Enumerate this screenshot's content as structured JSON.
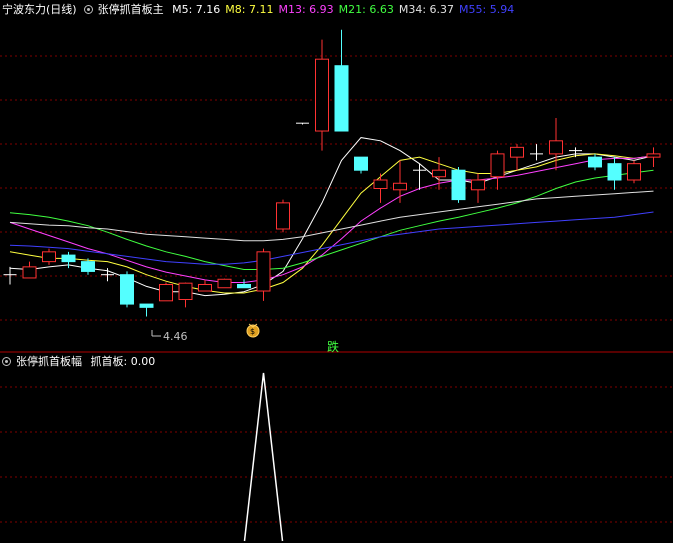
{
  "main_panel": {
    "stock_label": "宁波东力(日线)",
    "indicator_name": "张停抓首板主",
    "ma_readouts": [
      {
        "label": "M5: 7.16",
        "color": "#ffffff"
      },
      {
        "label": "M8: 7.11",
        "color": "#ffff40"
      },
      {
        "label": "M13: 6.93",
        "color": "#ff40ff"
      },
      {
        "label": "M21: 6.63",
        "color": "#40ff40"
      },
      {
        "label": "M34: 6.37",
        "color": "#e0e0e0"
      },
      {
        "label": "M55: 5.94",
        "color": "#4040ff"
      }
    ],
    "low_marker": "4.46",
    "signal_text": "跌",
    "signal_icon": "money-bag-icon"
  },
  "sub_panel": {
    "indicator_name": "张停抓首板幅",
    "readout": "抓首板: 0.00"
  },
  "colors": {
    "up": "#ff3232",
    "down": "#54ffff",
    "grid": "#800000",
    "signal": "#40ff40"
  },
  "chart_data": [
    {
      "type": "candlestick",
      "title": "宁波东力(日线)",
      "ylim": [
        4.1,
        9.0
      ],
      "candles": [
        {
          "o": 5.1,
          "h": 5.22,
          "l": 4.95,
          "c": 5.1
        },
        {
          "o": 5.05,
          "h": 5.3,
          "l": 5.05,
          "c": 5.22
        },
        {
          "o": 5.3,
          "h": 5.5,
          "l": 5.25,
          "c": 5.45
        },
        {
          "o": 5.4,
          "h": 5.45,
          "l": 5.2,
          "c": 5.3
        },
        {
          "o": 5.3,
          "h": 5.35,
          "l": 5.1,
          "c": 5.15
        },
        {
          "o": 5.1,
          "h": 5.2,
          "l": 5.0,
          "c": 5.1
        },
        {
          "o": 5.1,
          "h": 5.15,
          "l": 4.6,
          "c": 4.65
        },
        {
          "o": 4.65,
          "h": 4.62,
          "l": 4.46,
          "c": 4.6
        },
        {
          "o": 4.7,
          "h": 4.98,
          "l": 4.7,
          "c": 4.95
        },
        {
          "o": 4.72,
          "h": 4.98,
          "l": 4.6,
          "c": 4.97
        },
        {
          "o": 4.85,
          "h": 5.02,
          "l": 4.85,
          "c": 4.95
        },
        {
          "o": 4.9,
          "h": 5.04,
          "l": 4.9,
          "c": 5.03
        },
        {
          "o": 4.95,
          "h": 5.03,
          "l": 4.9,
          "c": 4.9
        },
        {
          "o": 4.85,
          "h": 5.5,
          "l": 4.7,
          "c": 5.45
        },
        {
          "o": 5.8,
          "h": 6.25,
          "l": 5.75,
          "c": 6.2
        },
        {
          "o": 7.42,
          "h": 7.42,
          "l": 7.4,
          "c": 7.42
        },
        {
          "o": 7.3,
          "h": 8.7,
          "l": 7.0,
          "c": 8.4
        },
        {
          "o": 8.3,
          "h": 8.85,
          "l": 7.3,
          "c": 7.3
        },
        {
          "o": 6.9,
          "h": 6.9,
          "l": 6.65,
          "c": 6.7
        },
        {
          "o": 6.42,
          "h": 6.65,
          "l": 6.2,
          "c": 6.55
        },
        {
          "o": 6.4,
          "h": 6.85,
          "l": 6.2,
          "c": 6.5
        },
        {
          "o": 6.7,
          "h": 6.8,
          "l": 6.4,
          "c": 6.7
        },
        {
          "o": 6.6,
          "h": 6.9,
          "l": 6.4,
          "c": 6.7
        },
        {
          "o": 6.7,
          "h": 6.75,
          "l": 6.2,
          "c": 6.25
        },
        {
          "o": 6.4,
          "h": 6.65,
          "l": 6.2,
          "c": 6.55
        },
        {
          "o": 6.6,
          "h": 7.0,
          "l": 6.4,
          "c": 6.95
        },
        {
          "o": 6.9,
          "h": 7.1,
          "l": 6.7,
          "c": 7.05
        },
        {
          "o": 6.95,
          "h": 7.1,
          "l": 6.85,
          "c": 6.95
        },
        {
          "o": 6.95,
          "h": 7.5,
          "l": 6.7,
          "c": 7.15
        },
        {
          "o": 7.0,
          "h": 7.05,
          "l": 6.9,
          "c": 6.98
        },
        {
          "o": 6.9,
          "h": 6.95,
          "l": 6.7,
          "c": 6.75
        },
        {
          "o": 6.8,
          "h": 6.9,
          "l": 6.4,
          "c": 6.55
        },
        {
          "o": 6.55,
          "h": 6.85,
          "l": 6.5,
          "c": 6.8
        },
        {
          "o": 6.9,
          "h": 7.05,
          "l": 6.75,
          "c": 6.95
        }
      ],
      "series": [
        {
          "name": "M5",
          "color": "#ffffff",
          "values": [
            5.2,
            5.18,
            5.22,
            5.25,
            5.2,
            5.16,
            5.05,
            4.92,
            4.84,
            4.84,
            4.78,
            4.8,
            4.84,
            4.95,
            5.15,
            5.65,
            6.2,
            6.85,
            7.2,
            7.15,
            7.0,
            6.8,
            6.55,
            6.55,
            6.5,
            6.6,
            6.7,
            6.8,
            6.9,
            6.95,
            6.95,
            6.9,
            6.85,
            6.92
          ]
        },
        {
          "name": "M8",
          "color": "#ffff40",
          "values": [
            5.45,
            5.4,
            5.35,
            5.35,
            5.32,
            5.3,
            5.22,
            5.1,
            5.0,
            4.92,
            4.86,
            4.82,
            4.82,
            4.88,
            4.98,
            5.2,
            5.55,
            5.95,
            6.35,
            6.6,
            6.85,
            6.9,
            6.8,
            6.7,
            6.65,
            6.65,
            6.7,
            6.75,
            6.85,
            6.92,
            6.95,
            6.92,
            6.88,
            6.92
          ]
        },
        {
          "name": "M13",
          "color": "#ff40ff",
          "values": [
            5.9,
            5.8,
            5.7,
            5.6,
            5.5,
            5.42,
            5.32,
            5.22,
            5.14,
            5.08,
            5.02,
            4.98,
            4.98,
            5.02,
            5.1,
            5.22,
            5.4,
            5.65,
            5.92,
            6.12,
            6.3,
            6.42,
            6.5,
            6.55,
            6.55,
            6.58,
            6.62,
            6.68,
            6.74,
            6.8,
            6.86,
            6.88,
            6.88,
            6.92
          ]
        },
        {
          "name": "M21",
          "color": "#40ff40",
          "values": [
            6.05,
            6.02,
            5.98,
            5.92,
            5.85,
            5.75,
            5.64,
            5.54,
            5.45,
            5.38,
            5.3,
            5.24,
            5.18,
            5.18,
            5.2,
            5.28,
            5.38,
            5.48,
            5.58,
            5.68,
            5.78,
            5.85,
            5.92,
            5.98,
            6.05,
            6.12,
            6.2,
            6.3,
            6.42,
            6.52,
            6.58,
            6.62,
            6.66,
            6.7
          ]
        },
        {
          "name": "M34",
          "color": "#e0e0e0",
          "values": [
            5.9,
            5.88,
            5.86,
            5.85,
            5.82,
            5.8,
            5.76,
            5.72,
            5.7,
            5.68,
            5.66,
            5.64,
            5.62,
            5.62,
            5.64,
            5.68,
            5.74,
            5.8,
            5.86,
            5.92,
            5.98,
            6.02,
            6.06,
            6.1,
            6.14,
            6.18,
            6.22,
            6.26,
            6.28,
            6.3,
            6.32,
            6.34,
            6.36,
            6.38
          ]
        },
        {
          "name": "M55",
          "color": "#4040ff",
          "values": [
            5.55,
            5.54,
            5.52,
            5.5,
            5.46,
            5.42,
            5.38,
            5.34,
            5.3,
            5.28,
            5.26,
            5.26,
            5.28,
            5.32,
            5.38,
            5.44,
            5.5,
            5.56,
            5.62,
            5.68,
            5.72,
            5.76,
            5.8,
            5.82,
            5.84,
            5.86,
            5.88,
            5.9,
            5.92,
            5.94,
            5.96,
            5.98,
            6.02,
            6.06
          ]
        }
      ]
    },
    {
      "type": "line",
      "title": "张停抓首板幅",
      "ylim": [
        0,
        1
      ],
      "series": [
        {
          "name": "抓首板",
          "color": "#ffffff",
          "values": [
            0,
            0,
            0,
            0,
            0,
            0,
            0,
            0,
            0,
            0,
            0,
            0,
            0,
            1,
            0,
            0,
            0,
            0,
            0,
            0,
            0,
            0,
            0,
            0,
            0,
            0,
            0,
            0,
            0,
            0,
            0,
            0,
            0,
            0
          ]
        }
      ]
    }
  ]
}
